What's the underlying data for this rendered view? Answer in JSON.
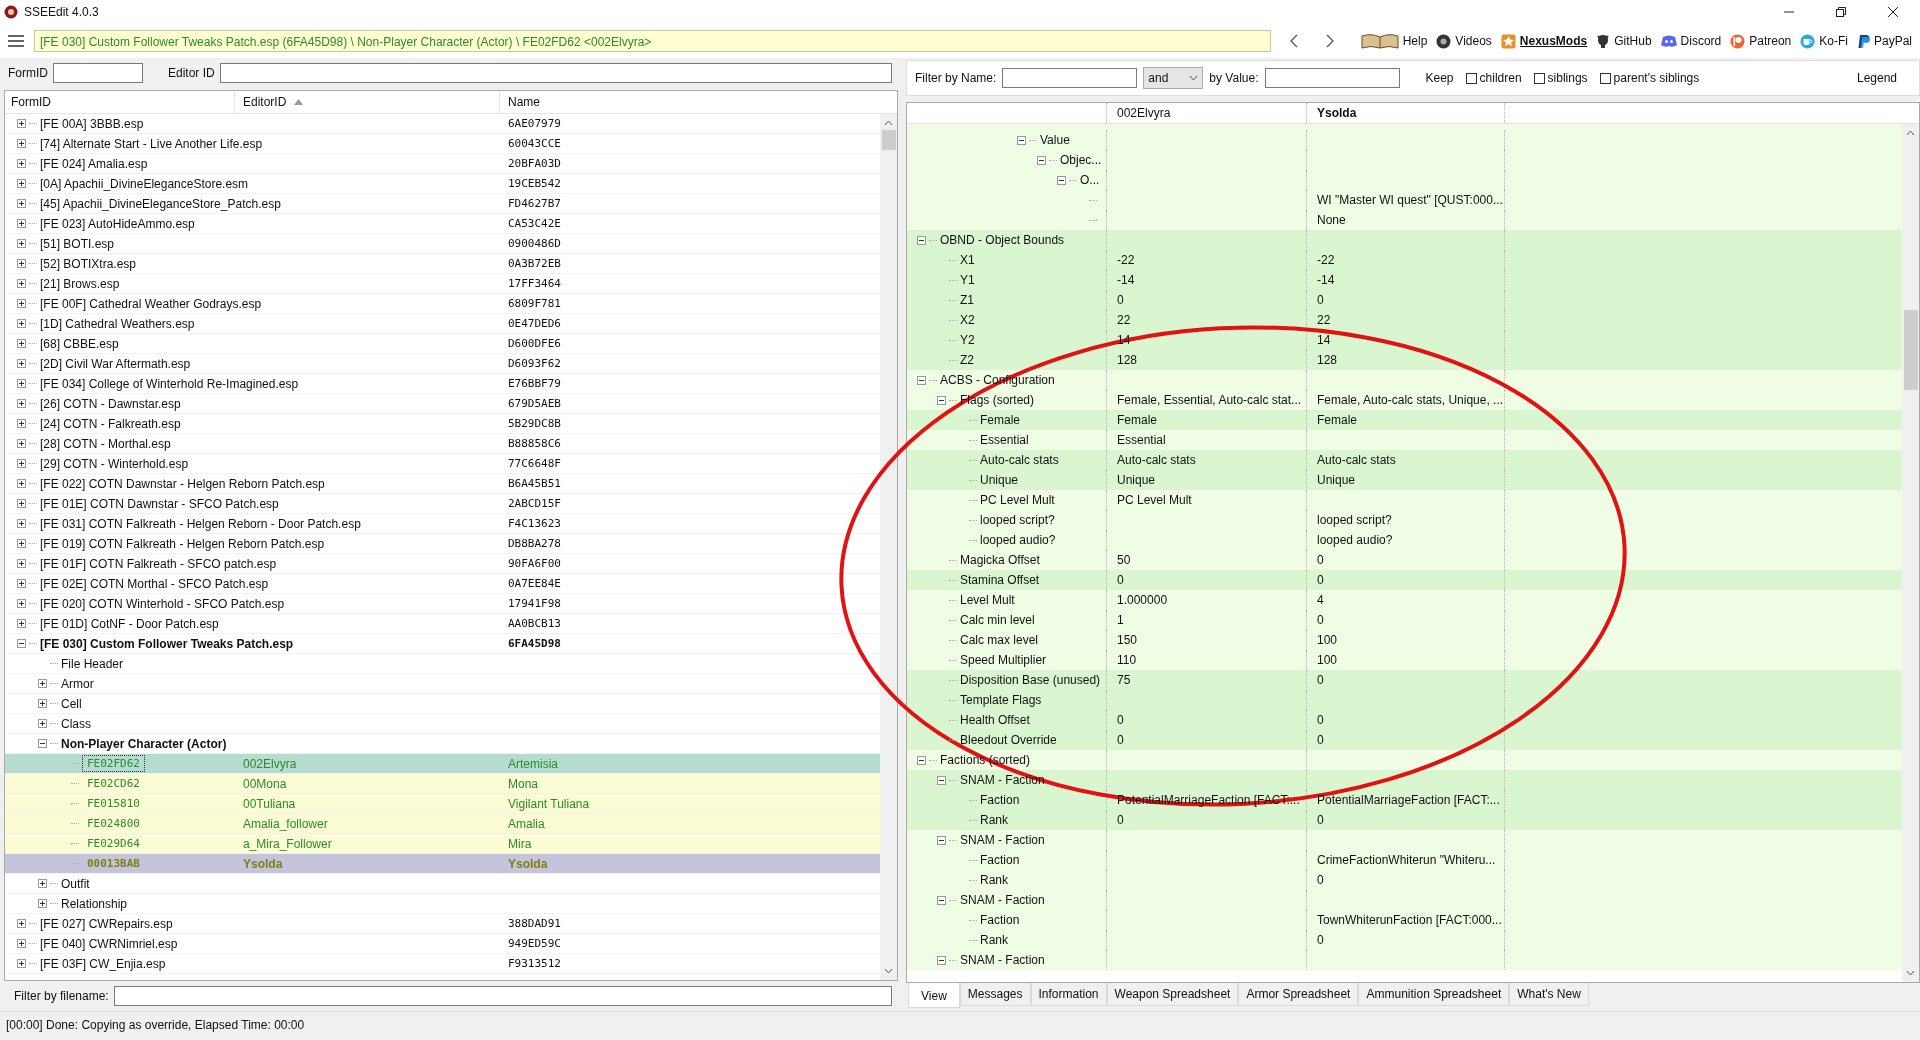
{
  "window": {
    "title": "SSEEdit 4.0.3"
  },
  "toolbar": {
    "path": "[FE 030] Custom Follower Tweaks Patch.esp (6FA45D98) \\ Non-Player Character (Actor) \\ FE02FD62 <002Elvyra>",
    "links": [
      {
        "label": "Help",
        "kind": "book",
        "active": false
      },
      {
        "label": "Videos",
        "kind": "reel",
        "active": false
      },
      {
        "label": "NexusMods",
        "kind": "nexus",
        "active": true
      },
      {
        "label": "GitHub",
        "kind": "github",
        "active": false
      },
      {
        "label": "Discord",
        "kind": "discord",
        "active": false
      },
      {
        "label": "Patreon",
        "kind": "patreon",
        "active": false
      },
      {
        "label": "Ko-Fi",
        "kind": "kofi",
        "active": false
      },
      {
        "label": "PayPal",
        "kind": "paypal",
        "active": false
      }
    ]
  },
  "id_fields": {
    "form_id_label": "FormID",
    "editor_id_label": "Editor ID"
  },
  "left_tree": {
    "columns": [
      {
        "label": "FormID",
        "sorted": false
      },
      {
        "label": "EditorID",
        "sorted": true
      },
      {
        "label": "Name",
        "sorted": false
      }
    ],
    "rows": [
      {
        "kind": "plugin",
        "label": "[FE 00A] 3BBB.esp",
        "name": "6AE07979",
        "expanded": false
      },
      {
        "kind": "plugin",
        "label": "[74] Alternate Start - Live Another Life.esp",
        "name": "60043CCE",
        "expanded": false
      },
      {
        "kind": "plugin",
        "label": "[FE 024] Amalia.esp",
        "name": "20BFA03D",
        "expanded": false
      },
      {
        "kind": "plugin",
        "label": "[0A] Apachii_DivineEleganceStore.esm",
        "name": "19CEB542",
        "expanded": false
      },
      {
        "kind": "plugin",
        "label": "[45] Apachii_DivineEleganceStore_Patch.esp",
        "name": "FD4627B7",
        "expanded": false
      },
      {
        "kind": "plugin",
        "label": "[FE 023] AutoHideAmmo.esp",
        "name": "CA53C42E",
        "expanded": false
      },
      {
        "kind": "plugin",
        "label": "[51] BOTI.esp",
        "name": "0900486D",
        "expanded": false
      },
      {
        "kind": "plugin",
        "label": "[52] BOTIXtra.esp",
        "name": "0A3B72EB",
        "expanded": false
      },
      {
        "kind": "plugin",
        "label": "[21] Brows.esp",
        "name": "17FF3464",
        "expanded": false
      },
      {
        "kind": "plugin",
        "label": "[FE 00F] Cathedral Weather Godrays.esp",
        "name": "6809F781",
        "expanded": false
      },
      {
        "kind": "plugin",
        "label": "[1D] Cathedral Weathers.esp",
        "name": "0E47DED6",
        "expanded": false
      },
      {
        "kind": "plugin",
        "label": "[68] CBBE.esp",
        "name": "D600DFE6",
        "expanded": false
      },
      {
        "kind": "plugin",
        "label": "[2D] Civil War Aftermath.esp",
        "name": "D6093F62",
        "expanded": false
      },
      {
        "kind": "plugin",
        "label": "[FE 034] College of Winterhold Re-Imagined.esp",
        "name": "E76BBF79",
        "expanded": false
      },
      {
        "kind": "plugin",
        "label": "[26] COTN - Dawnstar.esp",
        "name": "679D5AEB",
        "expanded": false
      },
      {
        "kind": "plugin",
        "label": "[24] COTN - Falkreath.esp",
        "name": "5B29DC8B",
        "expanded": false
      },
      {
        "kind": "plugin",
        "label": "[28] COTN - Morthal.esp",
        "name": "B88858C6",
        "expanded": false
      },
      {
        "kind": "plugin",
        "label": "[29] COTN - Winterhold.esp",
        "name": "77C6648F",
        "expanded": false
      },
      {
        "kind": "plugin",
        "label": "[FE 022] COTN Dawnstar - Helgen Reborn Patch.esp",
        "name": "B6A45B51",
        "expanded": false
      },
      {
        "kind": "plugin",
        "label": "[FE 01E] COTN Dawnstar - SFCO Patch.esp",
        "name": "2ABCD15F",
        "expanded": false
      },
      {
        "kind": "plugin",
        "label": "[FE 031] COTN Falkreath - Helgen Reborn - Door Patch.esp",
        "name": "F4C13623",
        "expanded": false
      },
      {
        "kind": "plugin",
        "label": "[FE 019] COTN Falkreath - Helgen Reborn Patch.esp",
        "name": "DB8BA278",
        "expanded": false
      },
      {
        "kind": "plugin",
        "label": "[FE 01F] COTN Falkreath - SFCO patch.esp",
        "name": "90FA6F00",
        "expanded": false
      },
      {
        "kind": "plugin",
        "label": "[FE 02E] COTN Morthal - SFCO Patch.esp",
        "name": "0A7EE84E",
        "expanded": false
      },
      {
        "kind": "plugin",
        "label": "[FE 020] COTN Winterhold - SFCO Patch.esp",
        "name": "17941F98",
        "expanded": false
      },
      {
        "kind": "plugin",
        "label": "[FE 01D] CotNF - Door Patch.esp",
        "name": "AA0BCB13",
        "expanded": false
      },
      {
        "kind": "plugin",
        "label": "[FE 030] Custom Follower Tweaks Patch.esp",
        "name": "6FA45D98",
        "expanded": true,
        "children": [
          {
            "kind": "header",
            "label": "File Header"
          },
          {
            "kind": "group",
            "label": "Armor",
            "expanded": false
          },
          {
            "kind": "group",
            "label": "Cell",
            "expanded": false
          },
          {
            "kind": "group",
            "label": "Class",
            "expanded": false
          },
          {
            "kind": "group",
            "label": "Non-Player Character (Actor)",
            "expanded": true,
            "children": [
              {
                "kind": "override",
                "form_id": "FE02FD62",
                "editor_id": "002Elvyra",
                "name": "Artemisia",
                "selected": true
              },
              {
                "kind": "override",
                "form_id": "FE02CD62",
                "editor_id": "00Mona",
                "name": "Mona",
                "selected": false
              },
              {
                "kind": "override",
                "form_id": "FE015810",
                "editor_id": "00Tuliana",
                "name": "Vigilant Tuliana",
                "selected": false
              },
              {
                "kind": "override",
                "form_id": "FE024800",
                "editor_id": "Amalia_follower",
                "name": "Amalia",
                "selected": false
              },
              {
                "kind": "override",
                "form_id": "FE029D64",
                "editor_id": "a_Mira_Follower",
                "name": "Mira",
                "selected": false
              },
              {
                "kind": "master",
                "form_id": "00013BAB",
                "editor_id": "Ysolda",
                "name": "Ysolda",
                "selected": false
              }
            ]
          },
          {
            "kind": "group",
            "label": "Outfit",
            "expanded": false
          },
          {
            "kind": "group",
            "label": "Relationship",
            "expanded": false
          }
        ]
      },
      {
        "kind": "plugin",
        "label": "[FE 027] CWRepairs.esp",
        "name": "388DAD91",
        "expanded": false
      },
      {
        "kind": "plugin",
        "label": "[FE 040] CWRNimriel.esp",
        "name": "949ED59C",
        "expanded": false
      },
      {
        "kind": "plugin",
        "label": "[FE 03F] CW_Enjia.esp",
        "name": "F9313512",
        "expanded": false
      }
    ]
  },
  "filename_filter": {
    "label": "Filter by filename:"
  },
  "status_bar": "[00:00] Done: Copying as override, Elapsed Time: 00:00",
  "filter": {
    "name_label": "Filter by Name:",
    "operator": "and",
    "value_label": "by Value:",
    "keep_label": "Keep",
    "options": [
      {
        "label": "children",
        "checked": false
      },
      {
        "label": "siblings",
        "checked": false
      },
      {
        "label": "parent's siblings",
        "checked": false
      }
    ],
    "legend": "Legend"
  },
  "record_view": {
    "columns": [
      {
        "label": "002Elvyra",
        "kind": "override"
      },
      {
        "label": "Ysolda",
        "kind": "master"
      }
    ],
    "scrolled_branch": [
      {
        "label": "Value",
        "expanded": true,
        "color": "#eefde4",
        "children": [
          {
            "label": "Objec...",
            "expanded": true,
            "color": "#eefde4",
            "children": [
              {
                "label": "O...",
                "expanded": true,
                "color": "#eefde4",
                "children": [
                  {
                    "color": "#eefde4",
                    "values": {
                      "master": "WI \"Master WI quest\" [QUST:000..."
                    }
                  },
                  {
                    "color": "#eefde4",
                    "values": {
                      "master": "None"
                    }
                  }
                ]
              }
            ]
          }
        ]
      }
    ],
    "rows": [
      {
        "label": "OBND - Object Bounds",
        "expanded": true,
        "color": "#d9f6d0",
        "children": [
          {
            "label": "X1",
            "color": "#d9f6d0",
            "values": {
              "override": "-22",
              "master": "-22"
            }
          },
          {
            "label": "Y1",
            "color": "#d9f6d0",
            "values": {
              "override": "-14",
              "master": "-14"
            }
          },
          {
            "label": "Z1",
            "color": "#d9f6d0",
            "values": {
              "override": "0",
              "master": "0"
            }
          },
          {
            "label": "X2",
            "color": "#d9f6d0",
            "values": {
              "override": "22",
              "master": "22"
            }
          },
          {
            "label": "Y2",
            "color": "#d9f6d0",
            "values": {
              "override": "14",
              "master": "14"
            }
          },
          {
            "label": "Z2",
            "color": "#d9f6d0",
            "values": {
              "override": "128",
              "master": "128"
            }
          }
        ]
      },
      {
        "label": "ACBS - Configuration",
        "expanded": true,
        "color": "#eefde4",
        "children": [
          {
            "label": "Flags (sorted)",
            "expanded": true,
            "color": "#eefde4",
            "values": {
              "override": "Female, Essential, Auto-calc stat...",
              "master": "Female, Auto-calc stats, Unique, ..."
            },
            "children": [
              {
                "label": "Female",
                "color": "#d9f6d0",
                "values": {
                  "override": "Female",
                  "master": "Female"
                }
              },
              {
                "label": "Essential",
                "color": "#eefde4",
                "values": {
                  "override": "Essential"
                }
              },
              {
                "label": "Auto-calc stats",
                "color": "#d9f6d0",
                "values": {
                  "override": "Auto-calc stats",
                  "master": "Auto-calc stats"
                }
              },
              {
                "label": "Unique",
                "color": "#d9f6d0",
                "values": {
                  "override": "Unique",
                  "master": "Unique"
                }
              },
              {
                "label": "PC Level Mult",
                "color": "#eefde4",
                "values": {
                  "override": "PC Level Mult"
                }
              },
              {
                "label": "looped script?",
                "color": "#eefde4",
                "values": {
                  "master": "looped script?"
                }
              },
              {
                "label": "looped audio?",
                "color": "#eefde4",
                "values": {
                  "master": "looped audio?"
                }
              }
            ]
          },
          {
            "label": "Magicka Offset",
            "color": "#eefde4",
            "values": {
              "override": "50",
              "master": "0"
            }
          },
          {
            "label": "Stamina Offset",
            "color": "#d9f6d0",
            "values": {
              "override": "0",
              "master": "0"
            }
          },
          {
            "label": "Level Mult",
            "color": "#eefde4",
            "values": {
              "override": "1.000000",
              "master": "4"
            }
          },
          {
            "label": "Calc min level",
            "color": "#eefde4",
            "values": {
              "override": "1",
              "master": "0"
            }
          },
          {
            "label": "Calc max level",
            "color": "#eefde4",
            "values": {
              "override": "150",
              "master": "100"
            }
          },
          {
            "label": "Speed Multiplier",
            "color": "#eefde4",
            "values": {
              "override": "110",
              "master": "100"
            }
          },
          {
            "label": "Disposition Base (unused)",
            "color": "#d9f6d0",
            "values": {
              "override": "75",
              "master": "0"
            }
          },
          {
            "label": "Template Flags",
            "color": "#d9f6d0"
          },
          {
            "label": "Health Offset",
            "color": "#d9f6d0",
            "values": {
              "override": "0",
              "master": "0"
            }
          },
          {
            "label": "Bleedout Override",
            "color": "#d9f6d0",
            "values": {
              "override": "0",
              "master": "0"
            }
          }
        ]
      },
      {
        "label": "Factions (sorted)",
        "expanded": true,
        "color": "#eefde4",
        "children": [
          {
            "label": "SNAM - Faction",
            "expanded": true,
            "color": "#d9f6d0",
            "children": [
              {
                "label": "Faction",
                "color": "#d9f6d0",
                "values": {
                  "override": "PotentialMarriageFaction [FACT:...",
                  "master": "PotentialMarriageFaction [FACT:..."
                }
              },
              {
                "label": "Rank",
                "color": "#d9f6d0",
                "values": {
                  "override": "0",
                  "master": "0"
                }
              }
            ]
          },
          {
            "label": "SNAM - Faction",
            "expanded": true,
            "color": "#eefde4",
            "children": [
              {
                "label": "Faction",
                "color": "#eefde4",
                "values": {
                  "master": "CrimeFactionWhiterun \"Whiteru..."
                }
              },
              {
                "label": "Rank",
                "color": "#eefde4",
                "values": {
                  "master": "0"
                }
              }
            ]
          },
          {
            "label": "SNAM - Faction",
            "expanded": true,
            "color": "#eefde4",
            "children": [
              {
                "label": "Faction",
                "color": "#eefde4",
                "values": {
                  "master": "TownWhiterunFaction [FACT:000..."
                }
              },
              {
                "label": "Rank",
                "color": "#eefde4",
                "values": {
                  "master": "0"
                }
              }
            ]
          },
          {
            "label": "SNAM - Faction",
            "expanded": true,
            "color": "#eefde4"
          }
        ]
      }
    ]
  },
  "tabs": [
    {
      "label": "View",
      "selected": true
    },
    {
      "label": "Messages",
      "selected": false
    },
    {
      "label": "Information",
      "selected": false
    },
    {
      "label": "Weapon Spreadsheet",
      "selected": false
    },
    {
      "label": "Armor Spreadsheet",
      "selected": false
    },
    {
      "label": "Ammunition Spreadsheet",
      "selected": false
    },
    {
      "label": "What's New",
      "selected": false
    }
  ]
}
